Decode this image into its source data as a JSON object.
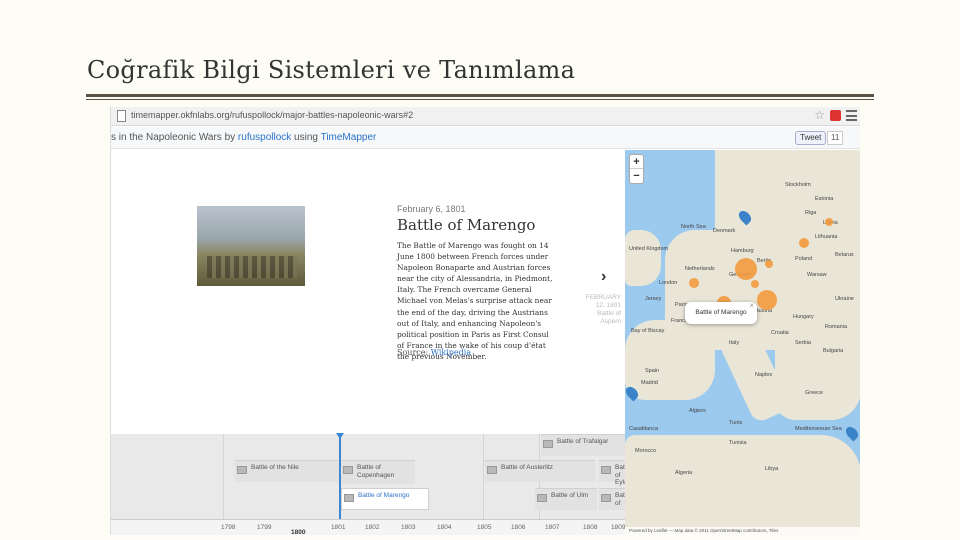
{
  "slide": {
    "title": "Coğrafik Bilgi Sistemleri ve Tanımlama"
  },
  "browser": {
    "url": "timemapper.okfnlabs.org/rufuspollock/major-battles-napoleonic-wars#2",
    "tweet_label": "Tweet",
    "tweet_count": "11"
  },
  "appbar": {
    "prefix": "s in the Napoleonic Wars by ",
    "author": "rufuspollock",
    "using": " using ",
    "app": "TimeMapper"
  },
  "story": {
    "date": "February 6, 1801",
    "title": "Battle of Marengo",
    "body": "The Battle of Marengo was fought on 14 June 1800 between French forces under Napoleon Bonaparte and Austrian forces near the city of Alessandria, in Piedmont, Italy. The French overcame General Michael von Melas's surprise attack near the end of the day, driving the Austrians out of Italy, and enhancing Napoleon's political position in Paris as First Consul of France in the wake of his coup d'état the previous November.",
    "source_label": "Source: ",
    "source_link": "Wikipedia",
    "next_date": "FEBRUARY 12, 1801",
    "next_sub": "Battle of Aspern"
  },
  "timeline": {
    "items": [
      {
        "label": "Battle of Trafalgar"
      },
      {
        "label": "Battle of the Nile"
      },
      {
        "label": "Battle of Copenhagen"
      },
      {
        "label": "Battle of Austerlitz"
      },
      {
        "label": "Battle of Eylau"
      },
      {
        "label": "Battle of Marengo"
      },
      {
        "label": "Battle of Ulm"
      },
      {
        "label": "Battle of"
      }
    ],
    "years": [
      "1798",
      "1799",
      "1801",
      "1802",
      "1803",
      "1804",
      "1805",
      "1806",
      "1807",
      "1808",
      "1809"
    ],
    "major_year": "1800"
  },
  "map": {
    "popup": "Battle of Marengo",
    "labels": {
      "stockholm": "Stockholm",
      "estonia": "Estonia",
      "riga": "Riga",
      "latvia": "Latvia",
      "lithuania": "Lithuania",
      "north_sea": "North Sea",
      "denmark": "Denmark",
      "hamburg": "Hamburg",
      "berlin": "Berlin",
      "poland": "Poland",
      "warsaw": "Warsaw",
      "belarus": "Belarus",
      "ukraine": "Ukraine",
      "united_kingdom": "United Kingdom",
      "netherlands": "Netherlands",
      "germany": "Germany",
      "london": "London",
      "jersey": "Jersey",
      "paris": "Paris",
      "france": "France",
      "austria": "Austria",
      "hungary": "Hungary",
      "romania": "Romania",
      "bay_of_biscay": "Bay of Biscay",
      "italy": "Italy",
      "croatia": "Croatia",
      "serbia": "Serbia",
      "bulgaria": "Bulgaria",
      "spain": "Spain",
      "madrid": "Madrid",
      "naples": "Naples",
      "greece": "Greece",
      "algiers": "Algiers",
      "tunisia": "Tunisia",
      "casablanca": "Casablanca",
      "morocco": "Morocco",
      "algeria": "Algeria",
      "libya": "Libya",
      "med_sea": "Mediterranean Sea",
      "tunis": "Tunis"
    },
    "attribution": "Powered by Leaflet — Map data © 2011 OpenStreetMap contributors, Tiles"
  }
}
